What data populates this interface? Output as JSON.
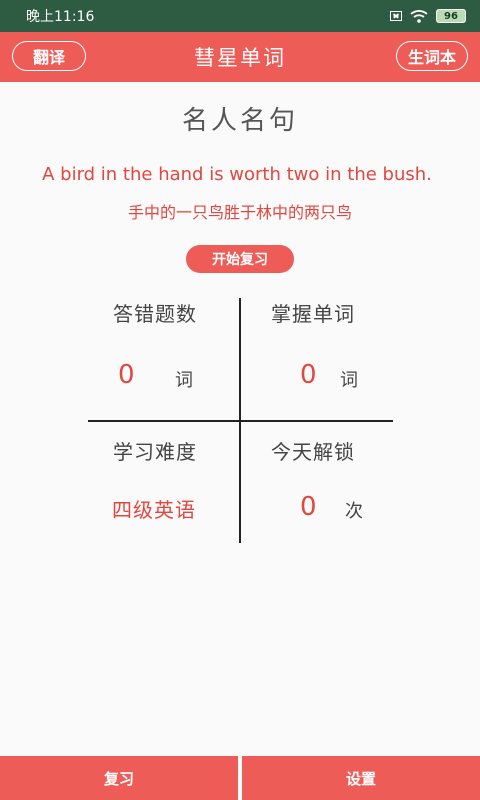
{
  "status_bar": {
    "time": "晚上11:16",
    "battery": "96"
  },
  "header": {
    "left_button": "翻译",
    "title": "彗星单词",
    "right_button": "生词本"
  },
  "quote": {
    "title": "名人名句",
    "english": "A bird in the hand is worth two in the bush.",
    "chinese": "手中的一只鸟胜于林中的两只鸟"
  },
  "start_review_label": "开始复习",
  "stats": {
    "wrong": {
      "label": "答错题数",
      "value": "0",
      "unit": "词"
    },
    "mastered": {
      "label": "掌握单词",
      "value": "0",
      "unit": "词"
    },
    "difficulty": {
      "label": "学习难度",
      "value": "四级英语"
    },
    "unlock": {
      "label": "今天解锁",
      "value": "0",
      "unit": "次"
    }
  },
  "bottom_nav": {
    "review": "复习",
    "settings": "设置"
  }
}
